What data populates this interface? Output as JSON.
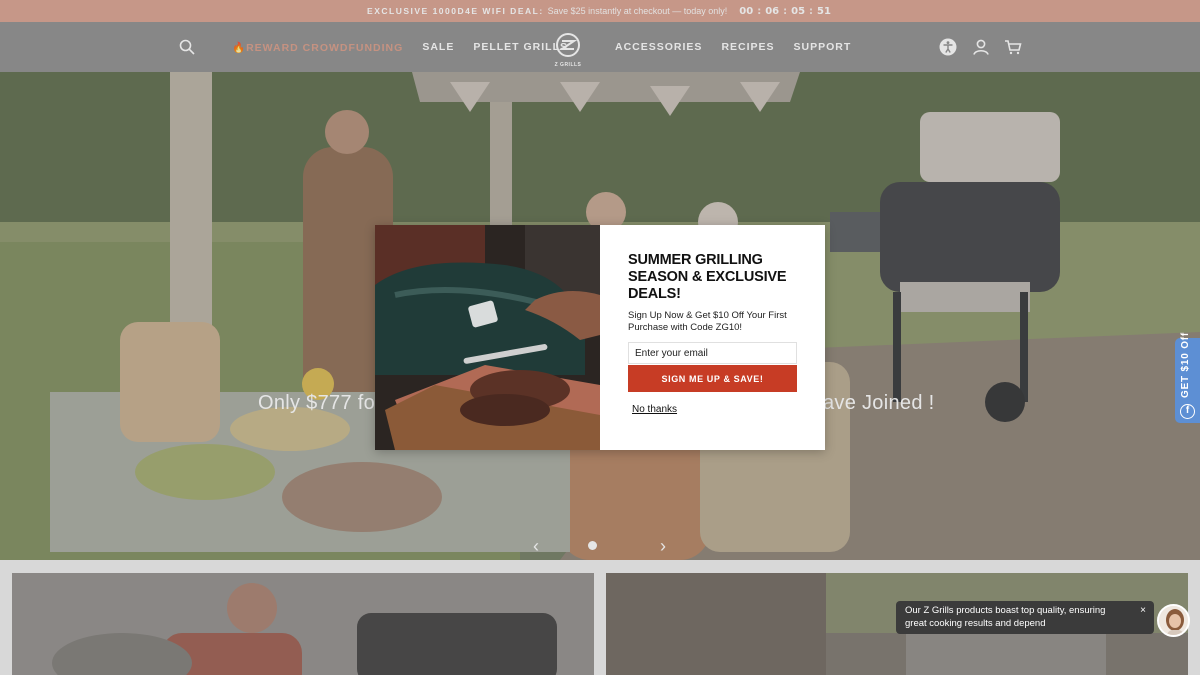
{
  "announcement": {
    "tag": "EXCLUSIVE 1000D4E WIFI DEAL:",
    "message": "Save $25 instantly at checkout — today only!",
    "timer": [
      "00",
      "06",
      "05",
      "51"
    ]
  },
  "header": {
    "nav_left": [
      "🔥REWARD CROWDFUNDING",
      "SALE",
      "PELLET GRILLS"
    ],
    "nav_right": [
      "ACCESSORIES",
      "RECIPES",
      "SUPPORT"
    ],
    "logo_text": "Z GRILLS",
    "icons": [
      "search-icon",
      "accessibility-icon",
      "account-icon",
      "cart-icon"
    ]
  },
  "hero": {
    "text_left": "Only $777 for",
    "text_right": "ave Joined !",
    "prev_label": "‹",
    "next_label": "›"
  },
  "modal": {
    "title": "SUMMER GRILLING SEASON & EXCLUSIVE DEALS!",
    "subtitle": "Sign Up Now & Get $10 Off Your First Purchase with Code ZG10!",
    "email_placeholder": "Enter your email",
    "button_label": "SIGN ME UP & SAVE!",
    "decline_label": "No thanks"
  },
  "side_tab": {
    "label": "GET $10 Off",
    "icon_glyph": "f"
  },
  "chat": {
    "message": "Our Z Grills products boast top quality, ensuring great cooking results and depend",
    "close_label": "×"
  },
  "colors": {
    "announce_bg": "#d9a08e",
    "header_bg": "#8d8d8d",
    "accent_red": "#c73c25",
    "side_tab_blue": "#5d8fd4"
  }
}
